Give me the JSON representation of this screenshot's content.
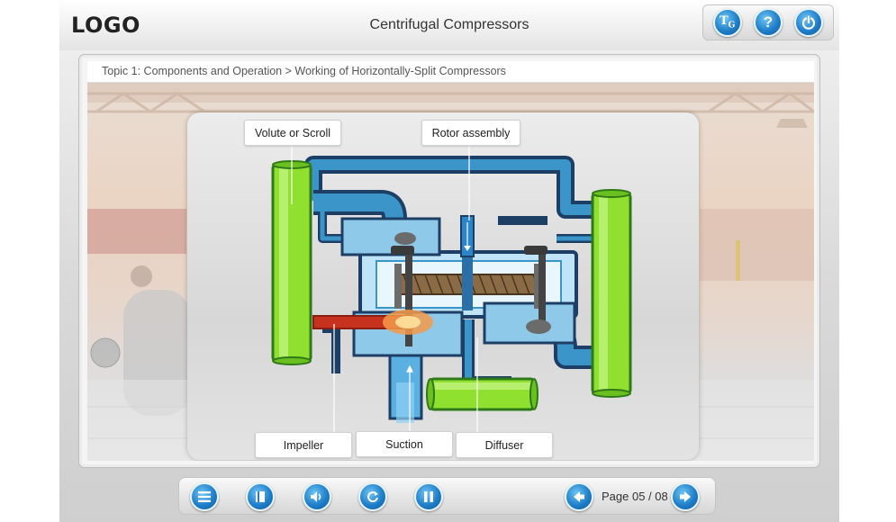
{
  "header": {
    "logo": "LOGO",
    "title": "Centrifugal Compressors",
    "buttons": [
      {
        "name": "glossary-button",
        "icon": "glossary-icon",
        "glyph": "T"
      },
      {
        "name": "help-button",
        "icon": "help-icon",
        "glyph": "?"
      },
      {
        "name": "exit-button",
        "icon": "power-icon",
        "glyph": "⏻"
      }
    ]
  },
  "breadcrumb": "Topic 1: Components and Operation > Working of Horizontally-Split Compressors",
  "diagram": {
    "labels": {
      "volute": "Volute or Scroll",
      "rotor": "Rotor assembly",
      "impeller": "Impeller",
      "suction": "Suction",
      "diffuser": "Diffuser"
    },
    "colors": {
      "pipe_blue": "#2d7fb4",
      "pipe_dark": "#1d3f66",
      "green": "#8fe02f",
      "red": "#d9341f"
    }
  },
  "footer": {
    "page": "Page 05 / 08",
    "buttons": [
      "menu-icon",
      "bookmark-icon",
      "audio-icon",
      "replay-icon",
      "pause-icon",
      "previous-icon",
      "next-icon"
    ]
  }
}
